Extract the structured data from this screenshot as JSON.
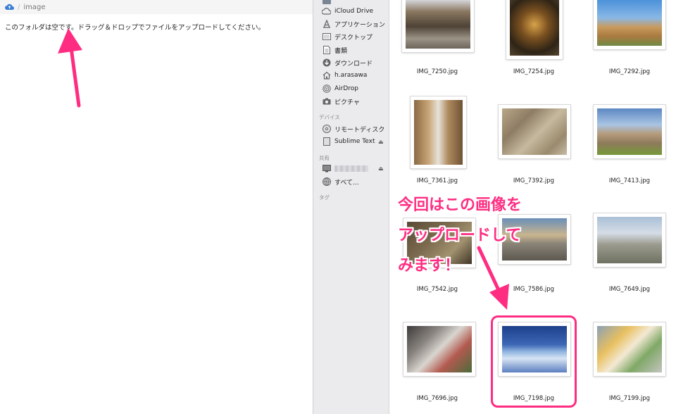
{
  "breadcrumb": {
    "separator": "/",
    "folder": "image"
  },
  "main": {
    "empty_message": "このフォルダは空です。ドラッグ＆ドロップでファイルをアップロードしてください。"
  },
  "sidebar": {
    "items": [
      {
        "label": "iCloud Drive",
        "icon": "cloud-icon"
      },
      {
        "label": "アプリケーション",
        "icon": "applications-icon"
      },
      {
        "label": "デスクトップ",
        "icon": "desktop-icon"
      },
      {
        "label": "書類",
        "icon": "documents-icon"
      },
      {
        "label": "ダウンロード",
        "icon": "download-icon"
      },
      {
        "label": "h.arasawa",
        "icon": "home-icon"
      },
      {
        "label": "AirDrop",
        "icon": "airdrop-icon"
      },
      {
        "label": "ピクチャ",
        "icon": "camera-icon"
      }
    ],
    "devices_header": "デバイス",
    "devices": [
      {
        "label": "リモートディスク",
        "icon": "disc-icon"
      },
      {
        "label": "Sublime Text",
        "icon": "drive-icon",
        "eject": "⏏"
      }
    ],
    "shared_header": "共有",
    "shared": [
      {
        "label": "",
        "icon": "computer-icon",
        "eject": "⏏"
      },
      {
        "label": "すべて...",
        "icon": "network-icon"
      }
    ],
    "tags_header": "タグ"
  },
  "files": [
    {
      "name": "IMG_7250.jpg"
    },
    {
      "name": "IMG_7254.jpg"
    },
    {
      "name": "IMG_7292.jpg"
    },
    {
      "name": "IMG_7361.jpg"
    },
    {
      "name": "IMG_7392.jpg"
    },
    {
      "name": "IMG_7413.jpg"
    },
    {
      "name": "IMG_7542.jpg"
    },
    {
      "name": "IMG_7586.jpg"
    },
    {
      "name": "IMG_7649.jpg"
    },
    {
      "name": "IMG_7696.jpg"
    },
    {
      "name": "IMG_7198.jpg"
    },
    {
      "name": "IMG_7199.jpg"
    }
  ],
  "annotation": {
    "line1": "今回はこの画像を",
    "line2": "アップロードして",
    "line3": "みます！"
  },
  "colors": {
    "accent": "#ff2d82",
    "sidebar_bg": "#ebebee"
  }
}
